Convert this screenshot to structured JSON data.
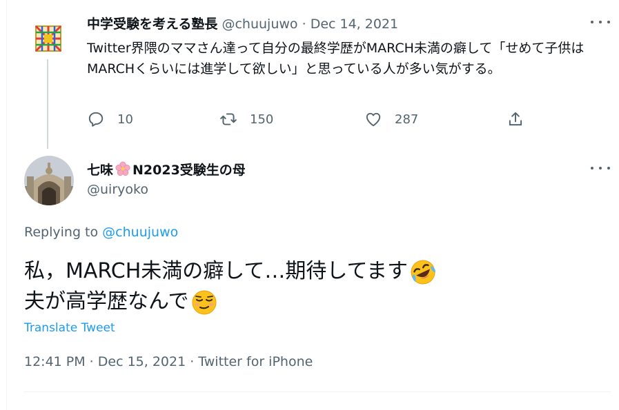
{
  "parent": {
    "name": "中学受験を考える塾長",
    "handle": "@chuujuwo",
    "separator": "·",
    "date": "Dec 14, 2021",
    "text": "Twitter界隈のママさん達って自分の最終学歴がMARCH未満の癖して「せめて子供はMARCHくらいには進学して欲しい」と思っている人が多い気がする。",
    "actions": {
      "replies": "10",
      "retweets": "150",
      "likes": "287"
    }
  },
  "reply": {
    "name_prefix": "七味",
    "name_suffix": "N2023受験生の母",
    "handle": "@uiryoko",
    "replying_prefix": "Replying to",
    "replying_handle": "@chuujuwo",
    "line1": "私，MARCH未満の癖して…期待してます",
    "line2": "夫が高学歴なんで",
    "translate_label": "Translate Tweet",
    "meta": "12:41 PM · Dec 15, 2021 · Twitter for iPhone"
  },
  "icons": {
    "reply": "reply-icon",
    "retweet": "retweet-icon",
    "like": "heart-icon",
    "share": "share-icon",
    "more": "more-icon",
    "flower": "cherry-blossom-emoji",
    "rofl": "rofl-emoji",
    "smirk": "relieved-emoji"
  },
  "colors": {
    "link": "#1d9bf0",
    "muted": "#536471",
    "text": "#0f1419",
    "line": "#cfd9de"
  }
}
